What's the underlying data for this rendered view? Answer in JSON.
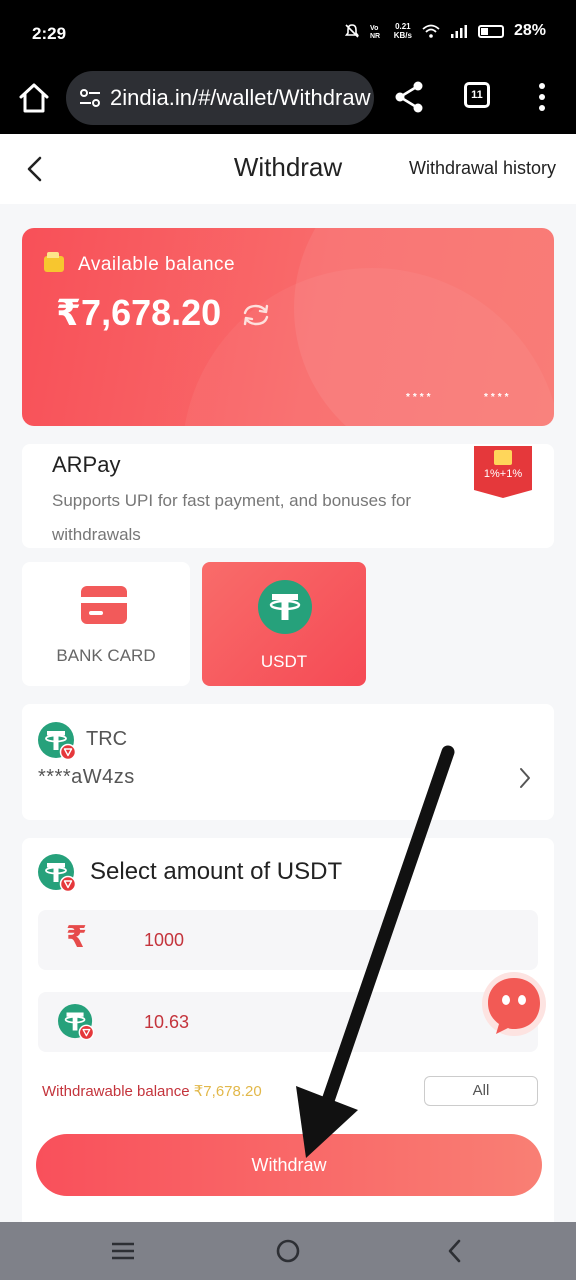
{
  "status_bar": {
    "time": "2:29",
    "net_speed_top": "0.21",
    "net_speed_bottom": "KB/s",
    "battery": "28%"
  },
  "browser": {
    "url": "2india.in/#/wallet/Withdraw",
    "tab_count": "11"
  },
  "header": {
    "title": "Withdraw",
    "history_link": "Withdrawal history"
  },
  "balance": {
    "label": "Available balance",
    "amount": "₹7,678.20",
    "card_mask_1": "****",
    "card_mask_2": "****"
  },
  "arpay": {
    "title": "ARPay",
    "description": "Supports UPI for fast payment, and bonuses for withdrawals",
    "badge": "1%+1%"
  },
  "methods": [
    {
      "label": "BANK CARD",
      "active": false
    },
    {
      "label": "USDT",
      "active": true
    }
  ],
  "address": {
    "network": "TRC",
    "value": "****aW4zs"
  },
  "amount": {
    "title": "Select amount of USDT",
    "inr_symbol": "₹",
    "inr_value": "1000",
    "usdt_value": "10.63",
    "withdrawable_label": "Withdrawable balance",
    "withdrawable_amount": "₹7,678.20",
    "all_label": "All",
    "withdraw_label": "Withdraw"
  },
  "colors": {
    "accent": "#f85058",
    "tether": "#26a17b",
    "text_red": "#c4343c"
  },
  "icons": {
    "home": "home-icon",
    "share": "share-icon",
    "menu": "more-vertical-icon",
    "back": "chevron-left-icon",
    "refresh": "refresh-icon",
    "tether": "tether-icon",
    "chat": "chat-icon"
  }
}
